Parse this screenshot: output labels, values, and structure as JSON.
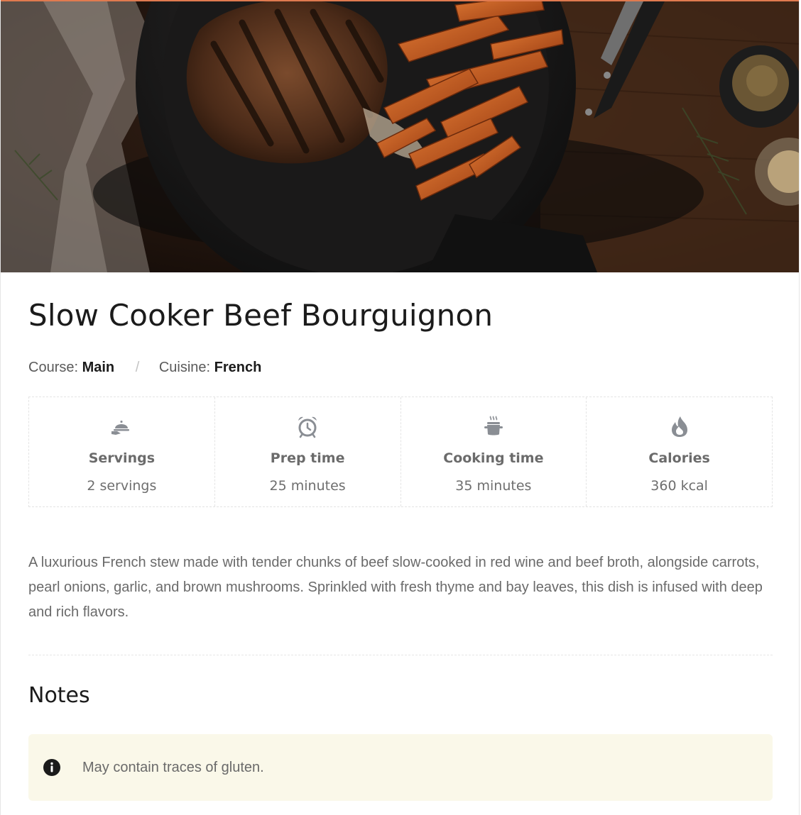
{
  "recipe": {
    "title": "Slow Cooker Beef Bourguignon",
    "course_label": "Course:",
    "course_value": "Main",
    "meta_separator": "/",
    "cuisine_label": "Cuisine:",
    "cuisine_value": "French",
    "stats": [
      {
        "icon": "serving-cloche-icon",
        "label": "Servings",
        "value": "2 servings"
      },
      {
        "icon": "alarm-clock-icon",
        "label": "Prep time",
        "value": "25 minutes"
      },
      {
        "icon": "cooking-pot-icon",
        "label": "Cooking time",
        "value": "35 minutes"
      },
      {
        "icon": "flame-icon",
        "label": "Calories",
        "value": "360 kcal"
      }
    ],
    "description": "A luxurious French stew made with tender chunks of beef slow-cooked in red wine and beef broth, alongside carrots, pearl onions, garlic, and brown mushrooms. Sprinkled with fresh thyme and bay leaves, this dish is infused with deep and rich flavors.",
    "notes_heading": "Notes",
    "note_text": "May contain traces of gluten."
  },
  "colors": {
    "accent_border": "#e07a4f",
    "note_background": "#faf8e9",
    "icon_gray": "#8a8e94"
  }
}
